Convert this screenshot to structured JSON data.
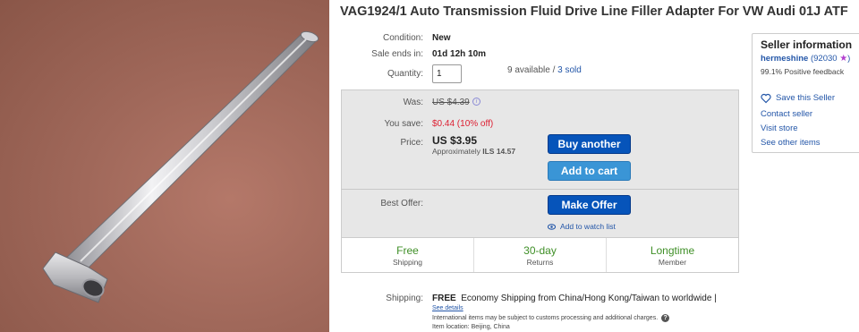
{
  "listing": {
    "title": "VAG1924/1 Auto Transmission Fluid Drive Line Filler Adapter For VW Audi 01J ATF",
    "condition_label": "Condition:",
    "condition_value": "New",
    "sale_ends_label": "Sale ends in:",
    "sale_ends_value": "01d 12h 10m",
    "quantity_label": "Quantity:",
    "quantity_value": "1",
    "available_text": "9 available",
    "available_sep": " / ",
    "sold_text": "3 sold"
  },
  "pricing": {
    "was_label": "Was:",
    "was_value": "US $4.39",
    "you_save_label": "You save:",
    "you_save_value": "$0.44 (10% off)",
    "price_label": "Price:",
    "price_value": "US $3.95",
    "approx_prefix": "Approximately",
    "approx_value": "ILS 14.57",
    "buy_another_label": "Buy another",
    "add_to_cart_label": "Add to cart",
    "best_offer_label": "Best Offer:",
    "make_offer_label": "Make Offer",
    "watch_label": "Add to watch list",
    "help_icon_glyph": "i"
  },
  "badges": [
    {
      "title": "Free",
      "subtitle": "Shipping"
    },
    {
      "title": "30-day",
      "subtitle": "Returns"
    },
    {
      "title": "Longtime",
      "subtitle": "Member"
    }
  ],
  "seller": {
    "heading": "Seller information",
    "name": "hermeshine",
    "score": "(92030",
    "score_close": ")",
    "feedback": "99.1% Positive feedback",
    "save_seller": "Save this Seller",
    "contact": "Contact seller",
    "visit_store": "Visit store",
    "other_items": "See other items"
  },
  "shipping": {
    "label": "Shipping:",
    "free": "FREE",
    "description": "Economy Shipping from China/Hong Kong/Taiwan to worldwide |",
    "see_details": "See details",
    "intl_note": "International items may be subject to customs processing and additional charges.",
    "location": "Item location:  Beijing, China"
  },
  "colors": {
    "accent_blue": "#0654ba",
    "light_blue": "#3a95d6",
    "green": "#3f8f27",
    "savings_red": "#dd1e31",
    "link_blue": "#2356a8"
  }
}
